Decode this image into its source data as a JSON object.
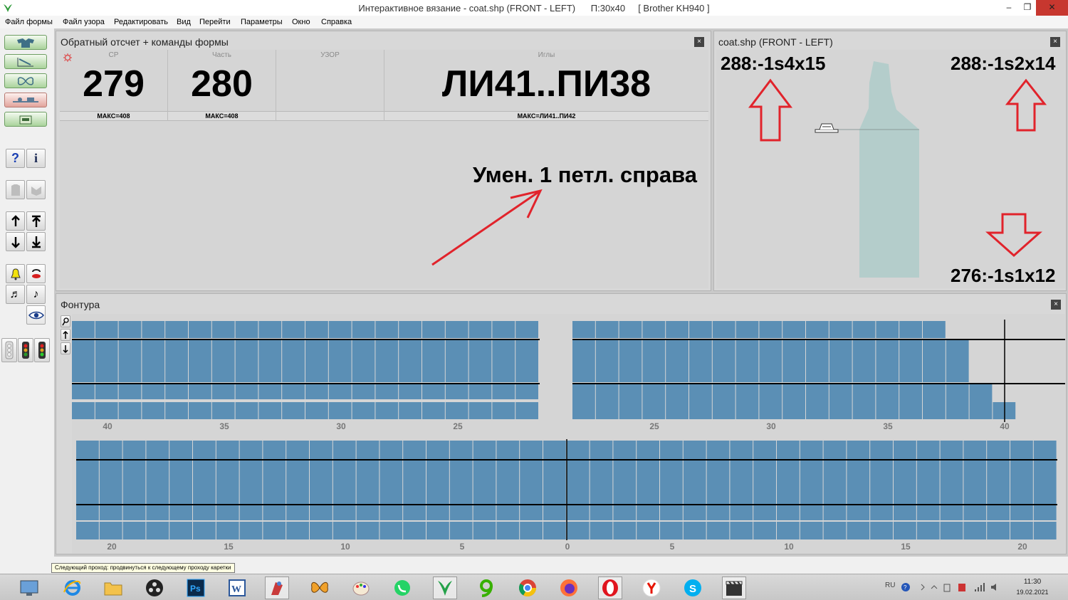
{
  "window": {
    "title": "Интерактивное вязание - coat.shp (FRONT - LEFT)      П:30x40     [ Brother KH940 ]",
    "min": "–",
    "max": "❐",
    "close": "✕"
  },
  "menu": [
    "Файл формы",
    "Файл узора",
    "Редактировать",
    "Вид",
    "Перейти",
    "Параметры",
    "Окно",
    "Справка"
  ],
  "counter_panel": {
    "title": "Обратный отсчет + команды формы",
    "close": "×",
    "cells": [
      {
        "label": "СР",
        "value": "279",
        "footer": "МАКС=408"
      },
      {
        "label": "Часть",
        "value": "280",
        "footer": "МАКС=408"
      },
      {
        "label": "УЗОР",
        "value": "",
        "footer": ""
      },
      {
        "label": "Иглы",
        "value": "ЛИ41..ПИ38",
        "footer": "МАКС=ЛИ41..ПИ42"
      }
    ],
    "command": "Умен. 1 петл. справа"
  },
  "shape_panel": {
    "title": "coat.shp (FRONT - LEFT)",
    "close": "×",
    "top_left": "288:-1s4x15",
    "top_right": "288:-1s2x14",
    "bottom_right": "276:-1s1x12"
  },
  "fontura_panel": {
    "title": "Фонтура",
    "close": "×",
    "top_left_ticks": [
      "40",
      "35",
      "30",
      "25"
    ],
    "top_right_ticks": [
      "25",
      "30",
      "35",
      "40"
    ],
    "bottom_ticks": [
      "20",
      "15",
      "10",
      "5",
      "0",
      "5",
      "10",
      "15",
      "20"
    ]
  },
  "tooltip": "Следующий проход: продвинуться к следующему проходу каретки",
  "taskbar": {
    "lang": "RU",
    "time": "11:30",
    "date": "19.02.2021"
  },
  "colors": {
    "needle_fill": "#5b8fb5",
    "needle_line": "#eaf1f6",
    "arrow_red": "#e1232b",
    "shape_fill": "#b4cdcb"
  }
}
